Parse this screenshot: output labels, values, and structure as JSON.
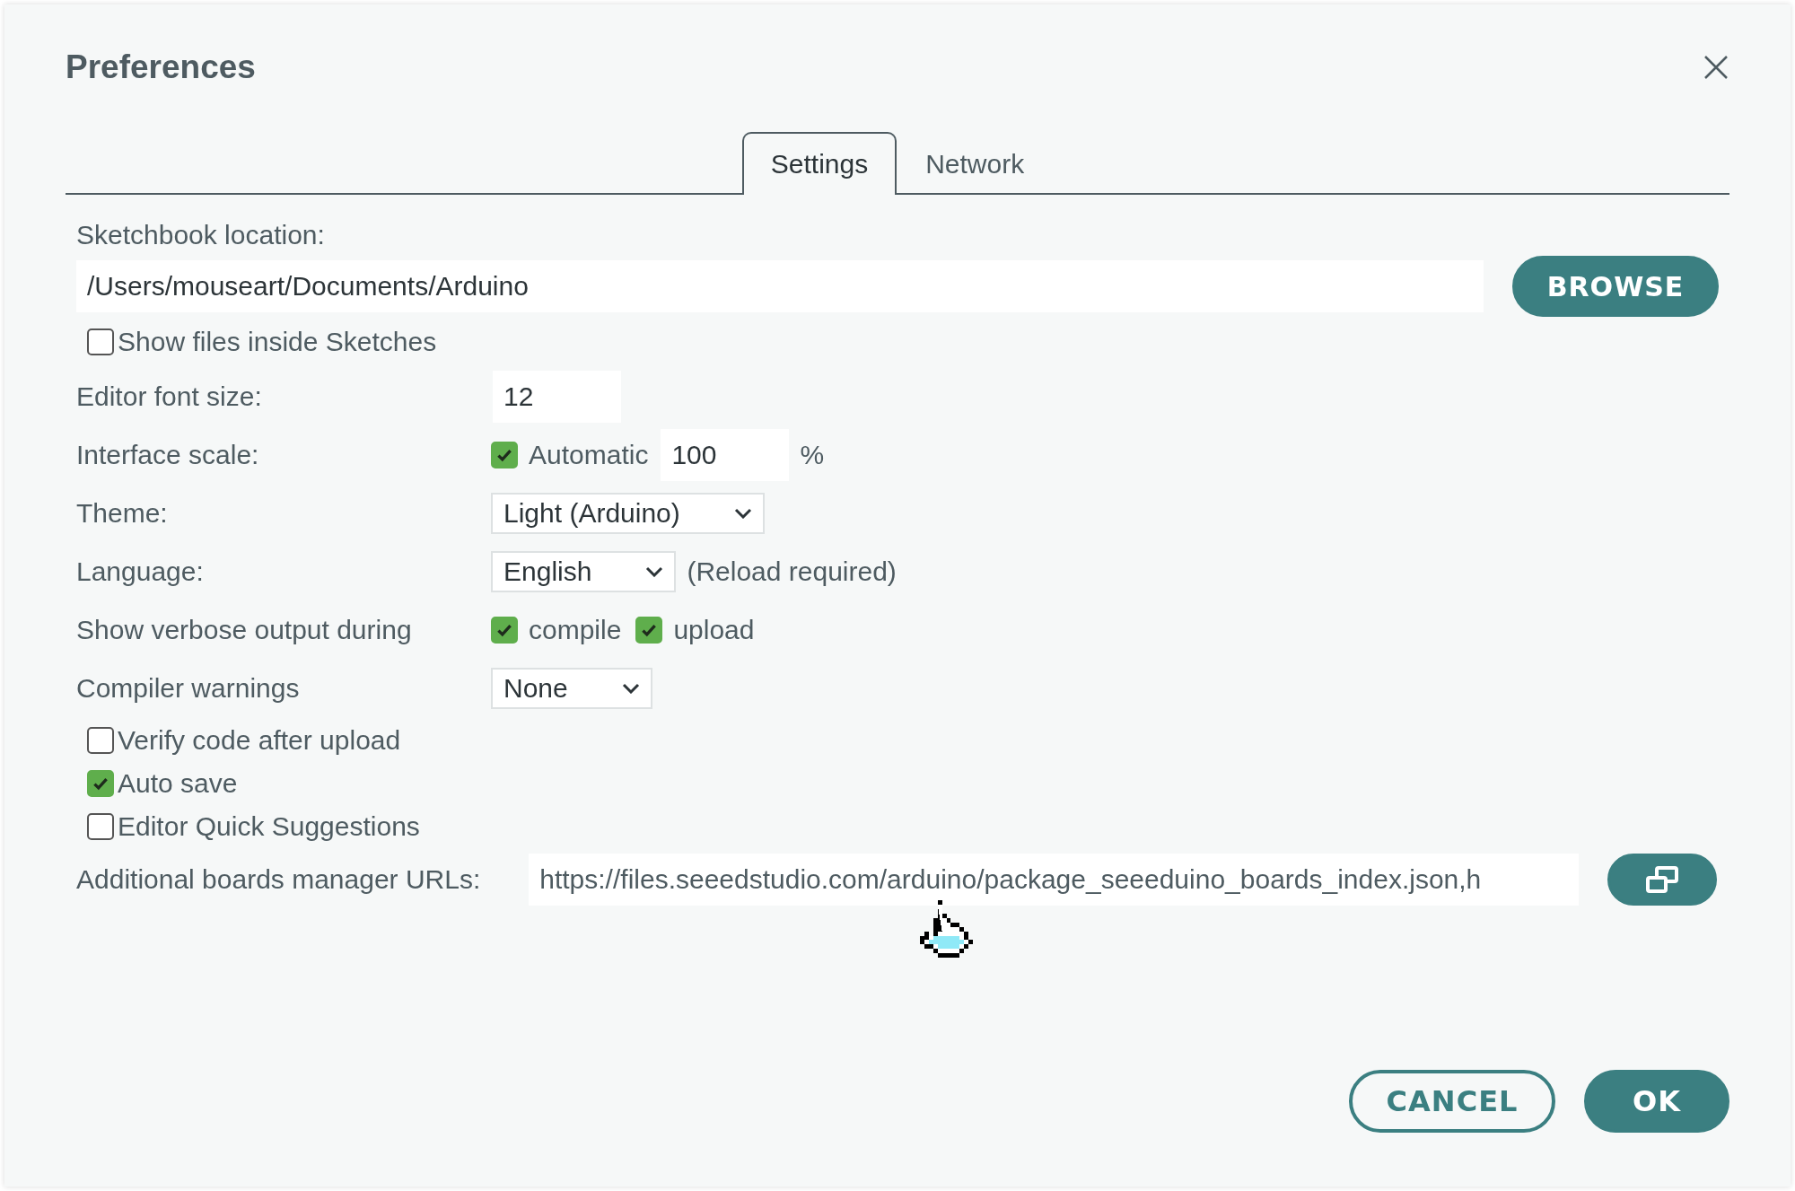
{
  "window": {
    "title": "Preferences"
  },
  "tabs": [
    {
      "label": "Settings",
      "selected": true
    },
    {
      "label": "Network",
      "selected": false
    }
  ],
  "sketchbook": {
    "label": "Sketchbook location:",
    "value": "/Users/mouseart/Documents/Arduino",
    "button": "BROWSE"
  },
  "show_files": {
    "label": "Show files inside Sketches",
    "checked": false
  },
  "rows": [
    {
      "kind": "input",
      "label": "Editor font size:",
      "value": "12"
    },
    {
      "kind": "scale",
      "label": "Interface scale:",
      "check_label": "Automatic",
      "checked": true,
      "value": "100",
      "unit": "%"
    },
    {
      "kind": "select",
      "label": "Theme:",
      "value": "Light (Arduino)"
    },
    {
      "kind": "select",
      "label": "Language:",
      "value": "English",
      "note": "(Reload required)"
    },
    {
      "kind": "checks",
      "label": "Show verbose output during",
      "checks": [
        {
          "label": "compile",
          "checked": true
        },
        {
          "label": "upload",
          "checked": true
        }
      ]
    },
    {
      "kind": "select",
      "label": "Compiler warnings",
      "value": "None"
    }
  ],
  "options": [
    {
      "label": "Verify code after upload",
      "checked": false
    },
    {
      "label": "Auto save",
      "checked": true
    },
    {
      "label": "Editor Quick Suggestions",
      "checked": false
    }
  ],
  "additional_urls": {
    "label": "Additional boards manager URLs:",
    "value": "https://files.seeedstudio.com/arduino/package_seeeduino_boards_index.json,h"
  },
  "buttons": [
    {
      "label": "CANCEL",
      "kind": "secondary"
    },
    {
      "label": "OK",
      "kind": "primary"
    }
  ]
}
